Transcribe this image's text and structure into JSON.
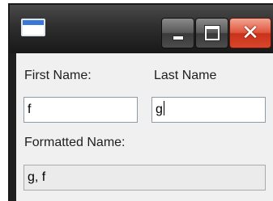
{
  "window": {
    "icon": "window-app-icon",
    "buttons": {
      "minimize_icon": "minimize-icon",
      "maximize_icon": "maximize-icon",
      "close_icon": "close-icon",
      "close_glyph": "✕",
      "close_color": "#d9462b"
    }
  },
  "form": {
    "first_name_label": "First Name:",
    "last_name_label": "Last Name",
    "first_name_value": "f",
    "last_name_value": "g",
    "formatted_name_label": "Formatted Name:",
    "formatted_name_value": "g, f"
  }
}
